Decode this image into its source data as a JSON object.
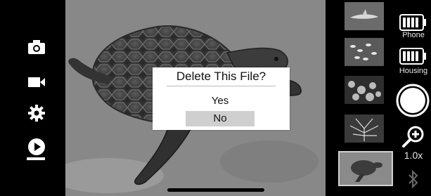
{
  "dialog": {
    "title": "Delete This File?",
    "options": [
      "Yes",
      "No"
    ],
    "selected_option": "No"
  },
  "sidebar": {
    "modes": [
      {
        "name": "photo",
        "icon": "camera-icon"
      },
      {
        "name": "video",
        "icon": "video-camera-icon"
      },
      {
        "name": "settings",
        "icon": "gear-icon"
      },
      {
        "name": "playback",
        "icon": "play-icon",
        "active": true
      }
    ]
  },
  "gallery": {
    "thumbnails": [
      {
        "subject": "shark"
      },
      {
        "subject": "school of fish"
      },
      {
        "subject": "coral reef"
      },
      {
        "subject": "sea fan coral"
      },
      {
        "subject": "sea turtle",
        "selected": true
      }
    ]
  },
  "status": {
    "phone_battery_label": "Phone",
    "housing_battery_label": "Housing",
    "zoom_level": "1.0x",
    "bluetooth_icon": "bluetooth-icon",
    "phone_battery_level": 1.0,
    "housing_battery_level": 1.0
  },
  "colors": {
    "background": "#000000",
    "dialog_background": "#ffffff",
    "selected_option_background": "#cfcfcf",
    "icon_color": "#ffffff"
  }
}
